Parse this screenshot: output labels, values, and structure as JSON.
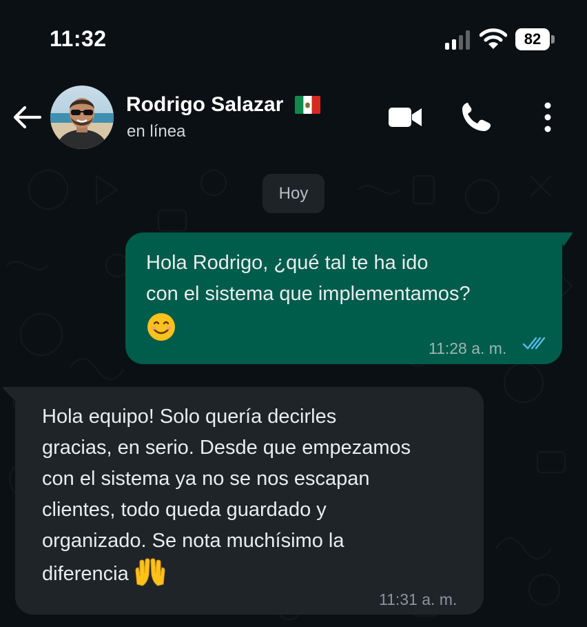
{
  "status_bar": {
    "time": "11:32",
    "battery_level": "82",
    "signal_icon": "cellular-signal-icon",
    "wifi_icon": "wifi-icon"
  },
  "header": {
    "contact_name": "Rodrigo Salazar",
    "contact_status": "en línea",
    "icons": [
      "back-arrow-icon",
      "avatar",
      "mexico-flag-icon",
      "video-camera-icon",
      "phone-icon",
      "more-vertical-icon"
    ]
  },
  "chat": {
    "date_label": "Hoy",
    "messages": [
      {
        "direction": "outgoing",
        "lines": [
          "Hola Rodrigo, ¿qué tal te ha ido",
          "con el sistema que implementamos?"
        ],
        "emoji": "😊",
        "time": "11:28 a. m.",
        "status": "read"
      },
      {
        "direction": "incoming",
        "lines": [
          "Hola equipo! Solo quería decirles",
          "gracias, en serio. Desde que empezamos",
          "con el sistema ya no se nos escapan",
          "clientes, todo queda guardado y",
          "organizado. Se nota muchísimo la",
          "diferencia"
        ],
        "emoji": "🙌",
        "time": "11:31 a. m."
      }
    ]
  },
  "colors": {
    "background": "#0b1014",
    "outgoing_bubble": "#005c4b",
    "incoming_bubble": "#1f2428",
    "read_ticks": "#53bdeb"
  }
}
